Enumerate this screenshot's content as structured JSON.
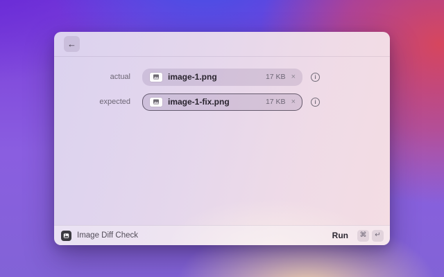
{
  "window": {
    "header": {
      "back_icon": "←"
    },
    "form": {
      "rows": [
        {
          "label": "actual",
          "file": {
            "name": "image-1.png",
            "size": "17 KB"
          }
        },
        {
          "label": "expected",
          "file": {
            "name": "image-1-fix.png",
            "size": "17 KB"
          }
        }
      ],
      "remove_icon": "×",
      "info_icon": "i"
    },
    "footer": {
      "app_title": "Image Diff Check",
      "run_label": "Run",
      "shortcuts": {
        "command": "⌘",
        "return": "↵"
      }
    }
  },
  "colors": {
    "focus_border": "#342c3e",
    "crimson": "#d6465e",
    "blue": "#3c54e9",
    "violet": "#6426d6",
    "warm_glow": "#f6d8a8"
  }
}
